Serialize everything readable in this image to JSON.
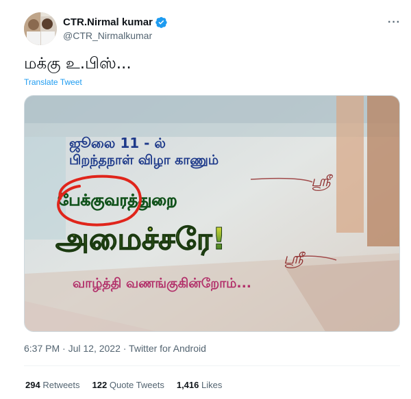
{
  "author": {
    "name": "CTR.Nirmal kumar",
    "handle": "@CTR_Nirmalkumar"
  },
  "more_label": "···",
  "tweet": {
    "text": "மக்கு உ.பிஸ்...",
    "translate_label": "Translate Tweet"
  },
  "media": {
    "line1": "ஜூலை 11 - ல்",
    "line2": "பிறந்தநாள் விழா காணும்",
    "line3": "பேக்குவரத்துறை",
    "line4": "அமைச்சரே!",
    "line5": "வாழ்த்தி வணங்குகின்றோம்...",
    "script_mark": "ஸ்ரீ"
  },
  "meta": {
    "time": "6:37 PM · Jul 12, 2022 · Twitter for Android"
  },
  "stats": {
    "retweets_count": "294",
    "retweets_label": "Retweets",
    "quotes_count": "122",
    "quotes_label": "Quote Tweets",
    "likes_count": "1,416",
    "likes_label": "Likes"
  },
  "colors": {
    "accent": "#1d9bf0",
    "verified": "#1d9bf0",
    "circle_annotation": "#e0251b"
  }
}
